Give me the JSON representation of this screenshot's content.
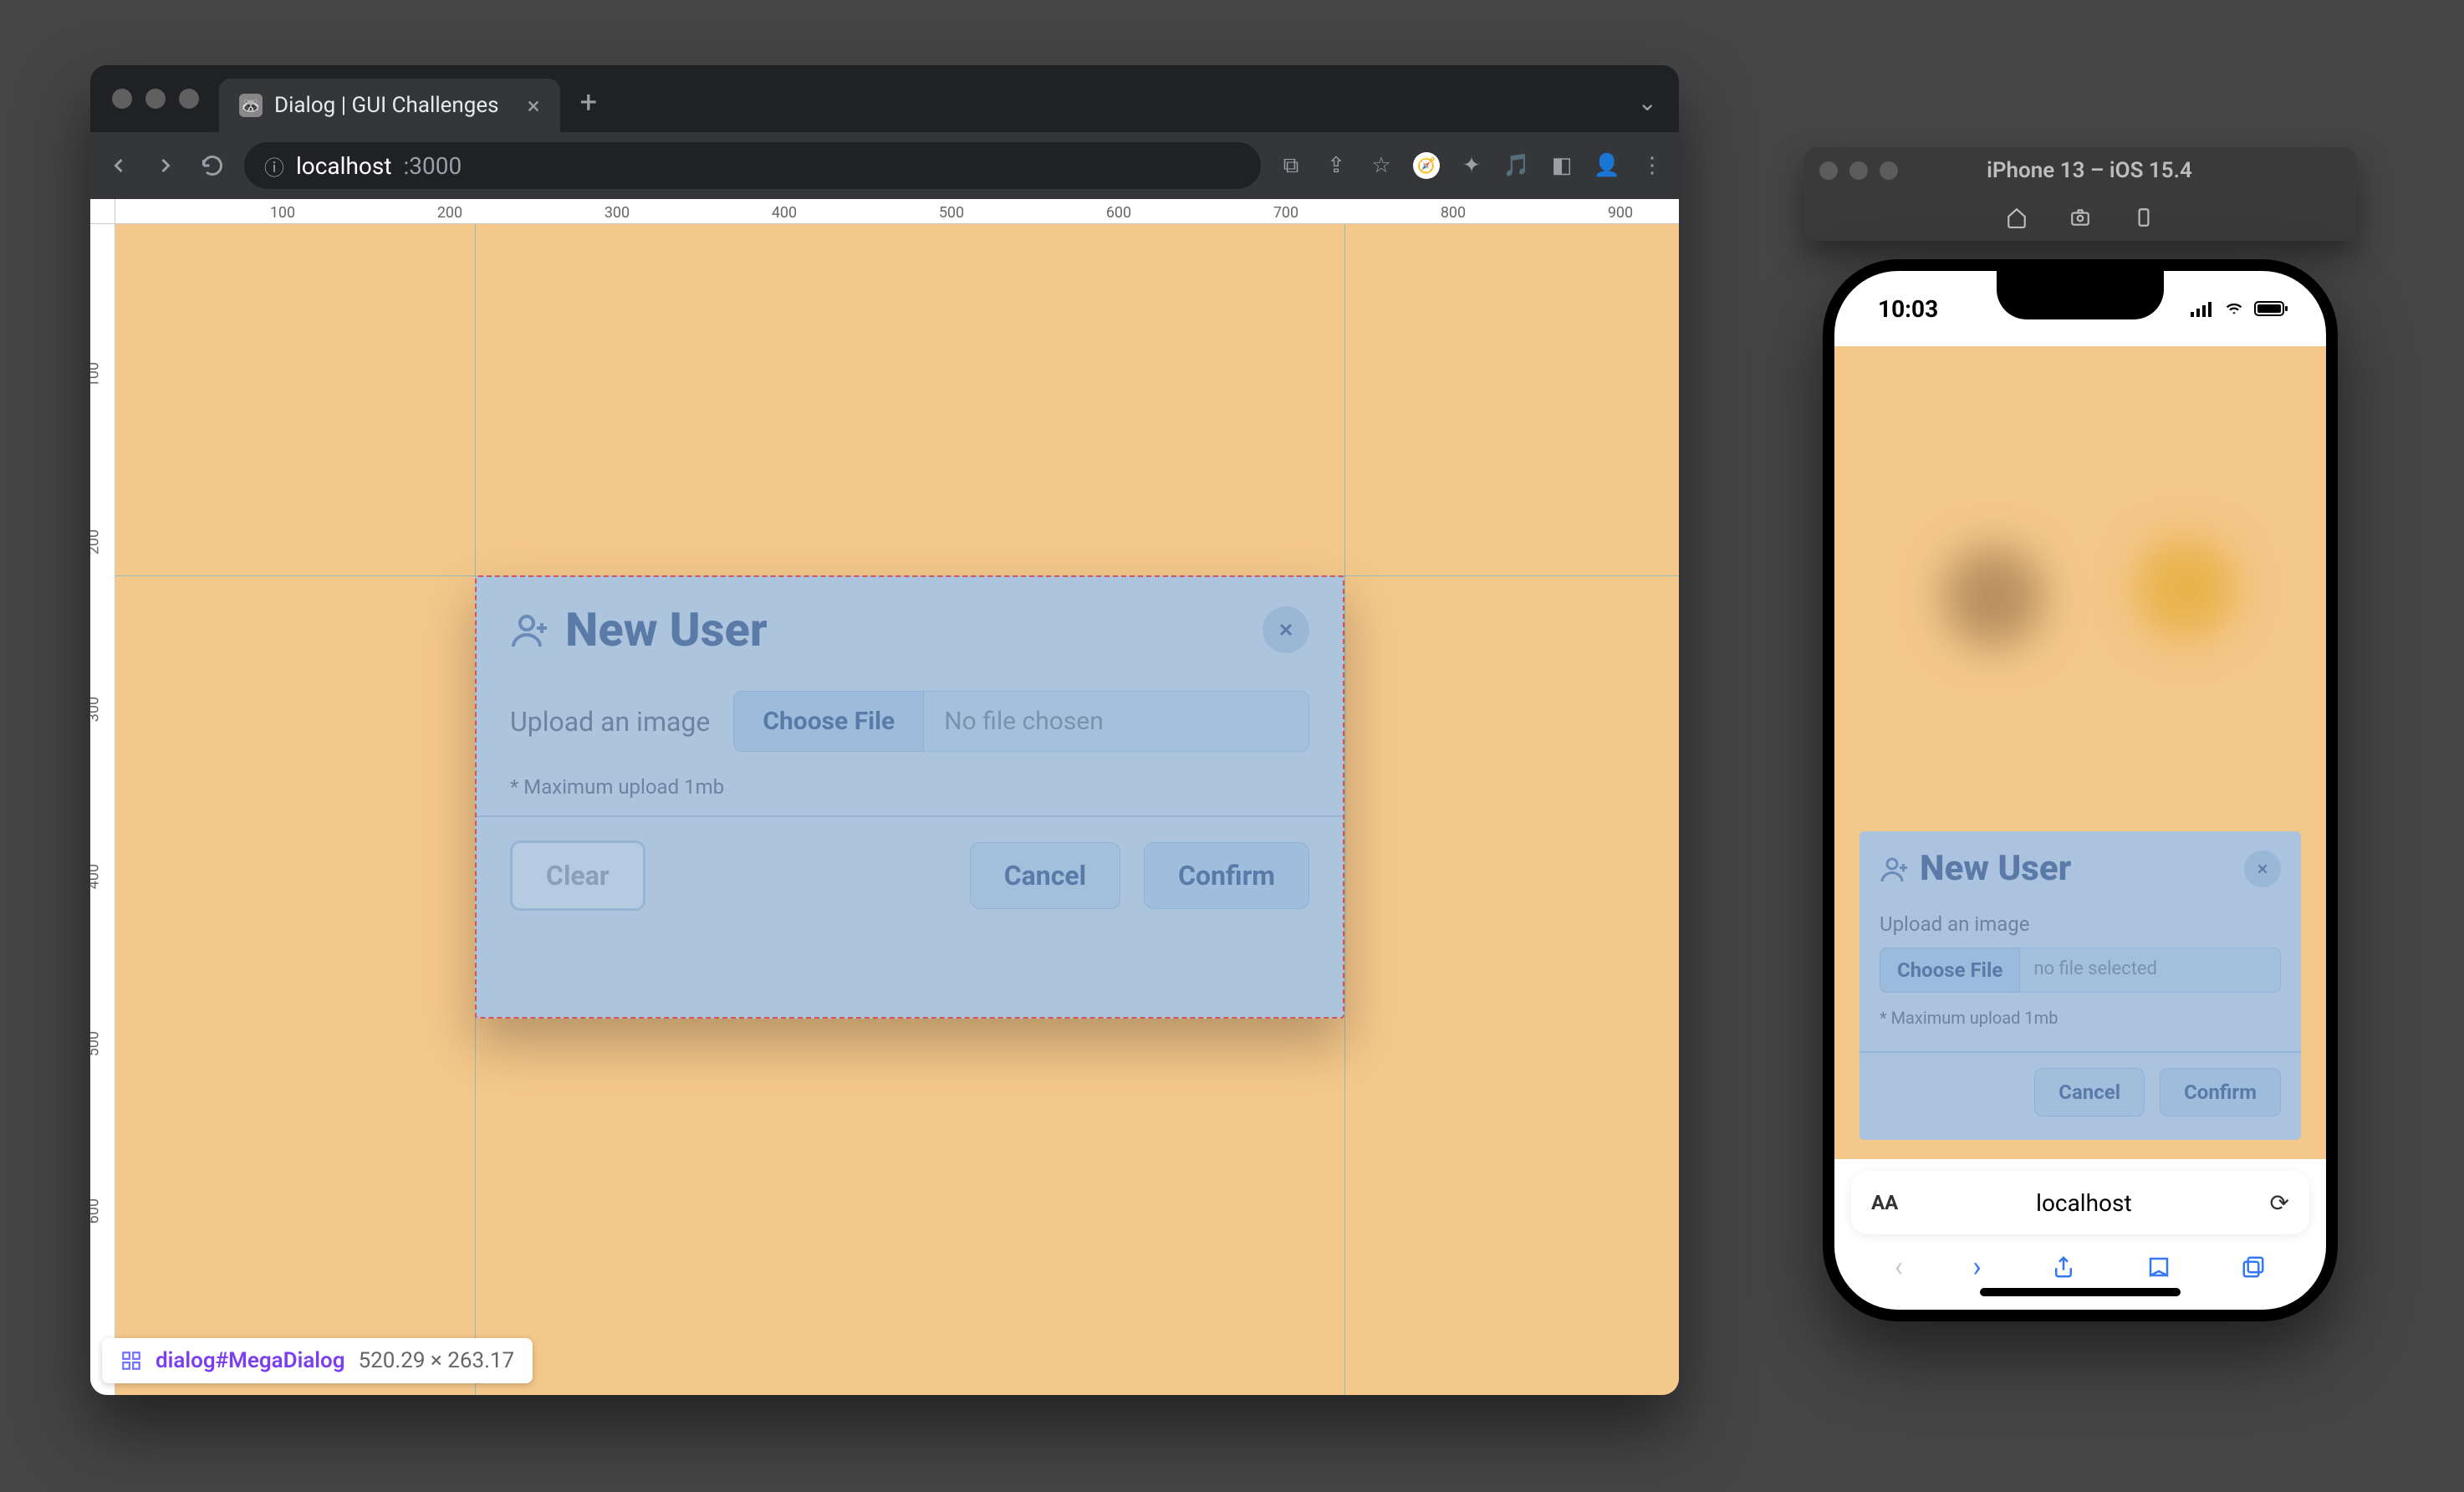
{
  "browser": {
    "tab_title": "Dialog | GUI Challenges",
    "url_host": "localhost",
    "url_port": ":3000",
    "nav": {
      "back": "←",
      "forward": "→",
      "reload": "⟳"
    }
  },
  "rulers": {
    "h": [
      "100",
      "200",
      "300",
      "400",
      "500",
      "600",
      "700",
      "800",
      "900"
    ],
    "v": [
      "100",
      "200",
      "300",
      "400",
      "500",
      "600"
    ]
  },
  "dialog": {
    "title": "New User",
    "upload_label": "Upload an image",
    "choose_label": "Choose File",
    "file_status": "No file chosen",
    "hint": "* Maximum upload 1mb",
    "clear": "Clear",
    "cancel": "Cancel",
    "confirm": "Confirm"
  },
  "devtools_badge": {
    "selector": "dialog#MegaDialog",
    "dimensions": "520.29 × 263.17"
  },
  "simulator": {
    "title": "iPhone 13 – iOS 15.4"
  },
  "phone": {
    "time": "10:03",
    "dialog": {
      "title": "New User",
      "upload_label": "Upload an image",
      "choose_label": "Choose File",
      "file_status": "no file selected",
      "hint": "* Maximum upload 1mb",
      "cancel": "Cancel",
      "confirm": "Confirm"
    },
    "safari_url": "localhost"
  }
}
